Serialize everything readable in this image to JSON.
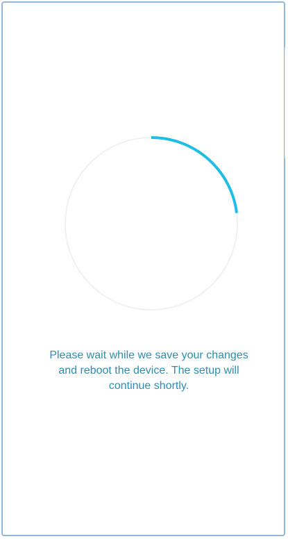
{
  "progress": {
    "fraction": 0.23,
    "track_color": "#f1f1f1",
    "arc_color": "#1ebee4"
  },
  "message": {
    "lines": [
      "Please wait while we save your changes",
      "and reboot the device. The setup will",
      "continue shortly."
    ],
    "color": "#2d8db2"
  }
}
